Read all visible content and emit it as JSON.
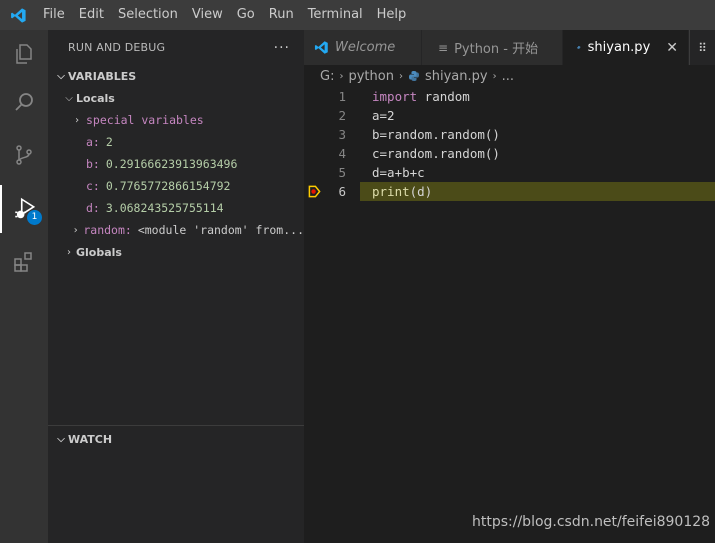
{
  "menu": [
    "File",
    "Edit",
    "Selection",
    "View",
    "Go",
    "Run",
    "Terminal",
    "Help"
  ],
  "activity": {
    "debug_badge": "1"
  },
  "sidebar": {
    "title": "RUN AND DEBUG",
    "more": "···",
    "variables_header": "VARIABLES",
    "locals_label": "Locals",
    "special_label": "special variables",
    "vars": [
      {
        "name": "a:",
        "value": "2"
      },
      {
        "name": "b:",
        "value": "0.29166623913963496"
      },
      {
        "name": "c:",
        "value": "0.7765772866154792"
      },
      {
        "name": "d:",
        "value": "3.068243525755114"
      }
    ],
    "random_name": "random:",
    "random_value": "<module 'random' from...",
    "globals_label": "Globals",
    "watch_header": "WATCH"
  },
  "tabs": [
    {
      "label": "Welcome"
    },
    {
      "label": "Python - 开始"
    },
    {
      "label": "shiyan.py"
    }
  ],
  "tab_close": "✕",
  "breadcrumb": [
    "G:",
    "python",
    "shiyan.py",
    "..."
  ],
  "code": {
    "line_numbers": [
      "1",
      "2",
      "3",
      "4",
      "5",
      "6"
    ],
    "l1_kw": "import",
    "l1_rest": " random",
    "l2": "a=2",
    "l3": "b=random.random()",
    "l4": "c=random.random()",
    "l5": "d=a+b+c",
    "l6_fn": "print",
    "l6_rest": "(d)"
  },
  "watermark": "https://blog.csdn.net/feifei890128",
  "colors": {
    "accent": "#007acc",
    "current_line": "#4b4b18",
    "breakpoint": "#ffcc00"
  }
}
